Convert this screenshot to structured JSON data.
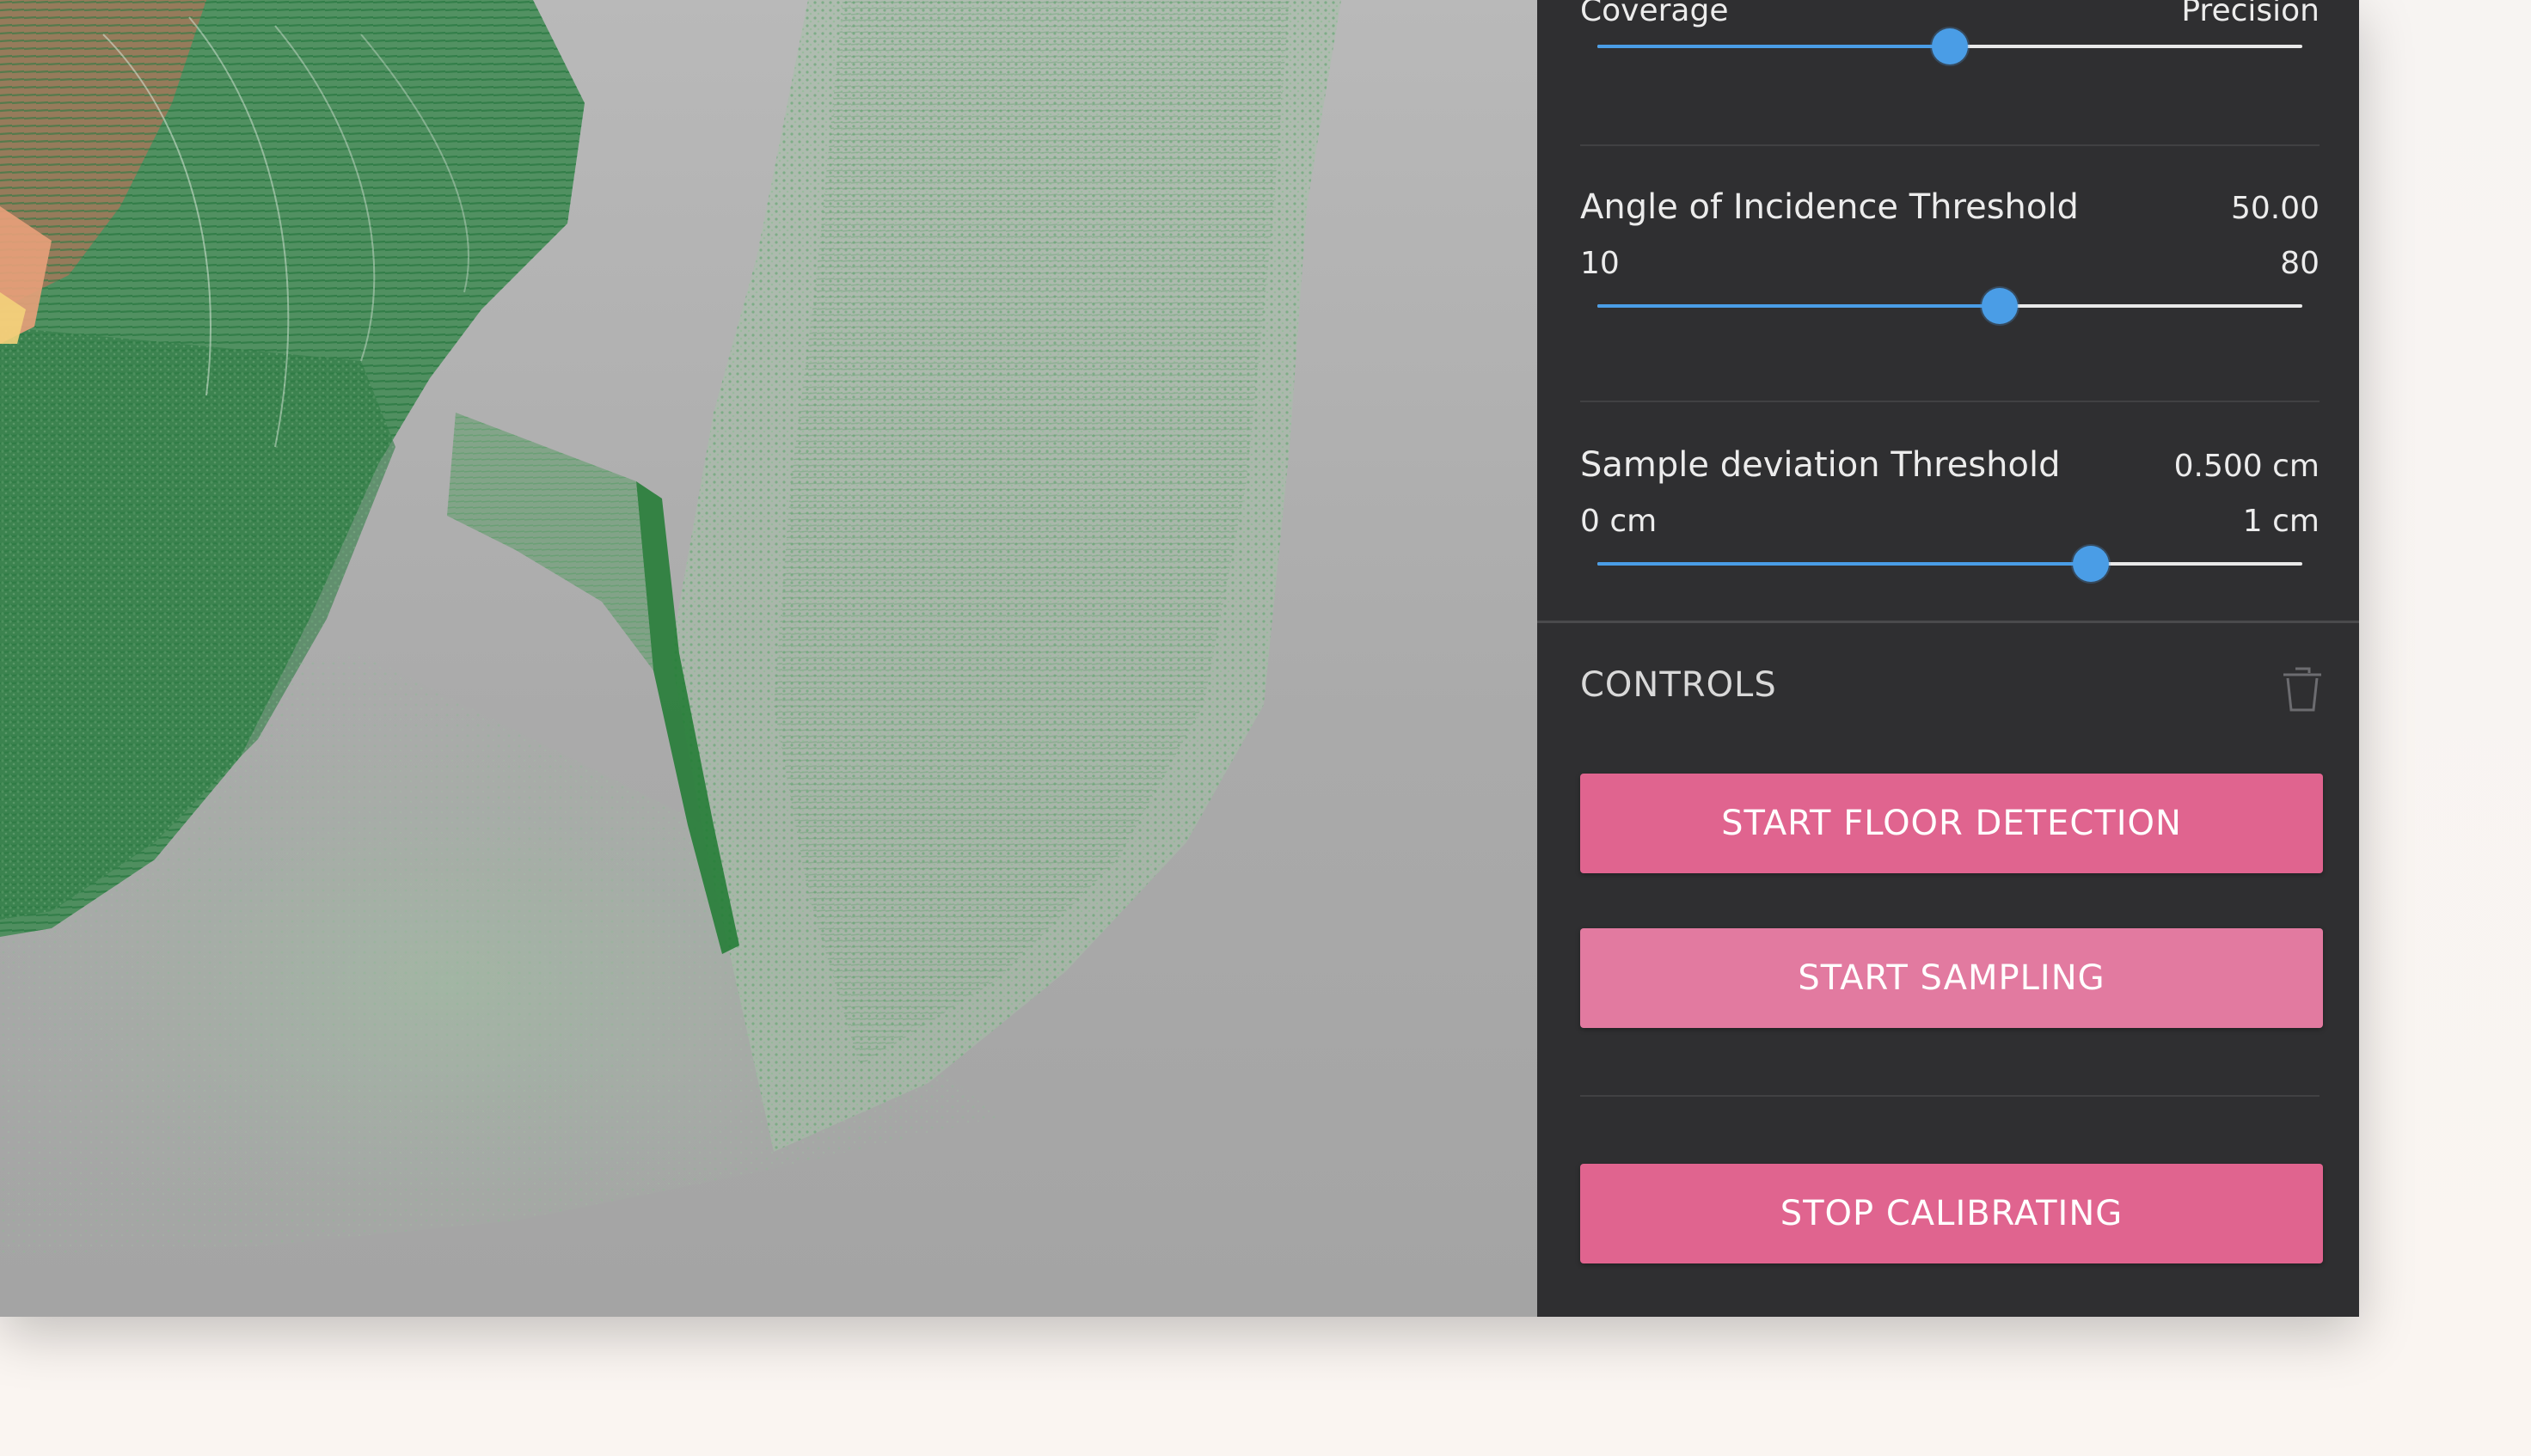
{
  "sliders": [
    {
      "id": "coverage-precision",
      "title": "",
      "value_label": "",
      "min_label": "Coverage",
      "max_label": "Precision",
      "fraction": 0.5
    },
    {
      "id": "angle-of-incidence",
      "title": "Angle of Incidence Threshold",
      "value_label": "50.00",
      "min_label": "10",
      "max_label": "80",
      "fraction": 0.571
    },
    {
      "id": "sample-deviation",
      "title": "Sample deviation Threshold",
      "value_label": "0.500 cm",
      "min_label": "0 cm",
      "max_label": "1 cm",
      "fraction": 0.7
    }
  ],
  "controls": {
    "header": "CONTROLS",
    "trash_icon": "trash-icon",
    "buttons": {
      "start_floor_detection": "START FLOOR DETECTION",
      "start_sampling": "START SAMPLING",
      "stop_calibrating": "STOP CALIBRATING"
    }
  },
  "colors": {
    "panel_bg": "#2f2f31",
    "accent_blue": "#4a9de6",
    "button_pink": "#e0648f",
    "button_pink_light": "#e27aa0",
    "viewport_bg": "#aaaaaa",
    "point_cloud_green": "#4c9a5c"
  }
}
